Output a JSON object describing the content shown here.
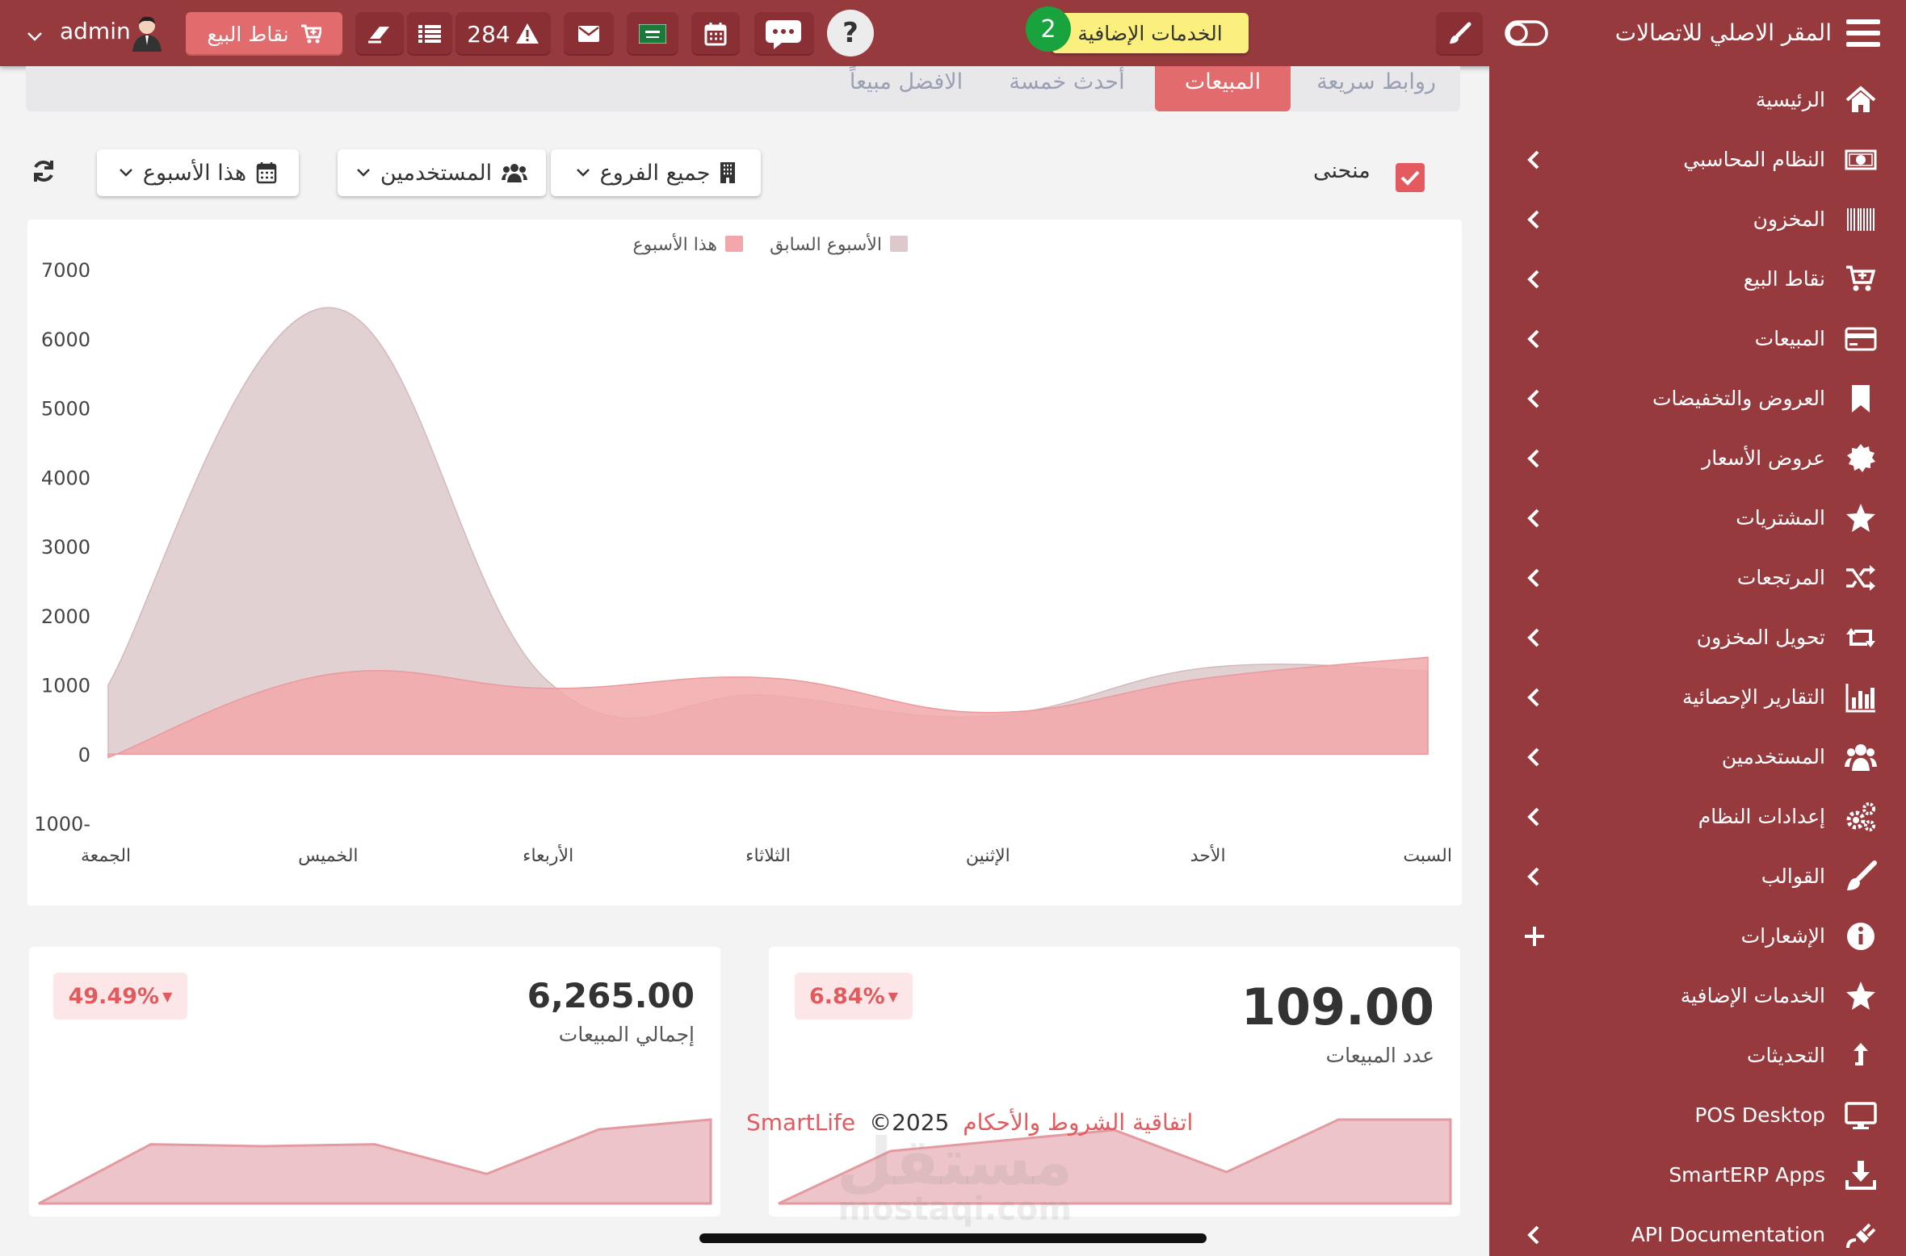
{
  "app": {
    "title": "المقر الاصلي للاتصالات"
  },
  "topbar": {
    "addons_label": "الخدمات الإضافية",
    "addons_badge": "2",
    "help_symbol": "?",
    "alerts_count": "284",
    "pos_label": "نقاط البيع",
    "user_name": "admin"
  },
  "sidebar": {
    "items": [
      {
        "label": "الرئيسية",
        "icon": "home-icon",
        "has_children": false
      },
      {
        "label": "النظام المحاسبي",
        "icon": "money-icon",
        "has_children": true
      },
      {
        "label": "المخزون",
        "icon": "barcode-icon",
        "has_children": true
      },
      {
        "label": "نقاط البيع",
        "icon": "cart-plus-icon",
        "has_children": true
      },
      {
        "label": "المبيعات",
        "icon": "credit-card-icon",
        "has_children": true
      },
      {
        "label": "العروض والتخفيضات",
        "icon": "bookmark-icon",
        "has_children": true
      },
      {
        "label": "عروض الأسعار",
        "icon": "certificate-icon",
        "has_children": true
      },
      {
        "label": "المشتريات",
        "icon": "star-icon",
        "has_children": true
      },
      {
        "label": "المرتجعات",
        "icon": "random-icon",
        "has_children": true
      },
      {
        "label": "تحويل المخزون",
        "icon": "retweet-icon",
        "has_children": true
      },
      {
        "label": "التقارير الإحصائية",
        "icon": "bar-chart-icon",
        "has_children": true
      },
      {
        "label": "المستخدمين",
        "icon": "users-icon",
        "has_children": true
      },
      {
        "label": "إعدادات النظام",
        "icon": "cogs-icon",
        "has_children": true
      },
      {
        "label": "القوالب",
        "icon": "brush-icon",
        "has_children": true
      },
      {
        "label": "الإشعارات",
        "icon": "info-icon",
        "has_children": false,
        "plus": true
      },
      {
        "label": "الخدمات الإضافية",
        "icon": "star-icon",
        "has_children": false
      },
      {
        "label": "التحديثات",
        "icon": "upload-arrow-icon",
        "has_children": false
      },
      {
        "label": "POS Desktop",
        "icon": "desktop-icon",
        "has_children": false
      },
      {
        "label": "SmartERP Apps",
        "icon": "download-icon",
        "has_children": false
      },
      {
        "label": "API Documentation",
        "icon": "plug-icon",
        "has_children": true
      }
    ]
  },
  "tabs": [
    {
      "label": "روابط سريعة",
      "active": false
    },
    {
      "label": "المبيعات",
      "active": true
    },
    {
      "label": "أحدث خمسة",
      "active": false
    },
    {
      "label": "الافضل مبيعاً",
      "active": false
    }
  ],
  "filters": {
    "curve_label": "منحنى",
    "curve_checked": true,
    "branches": "جميع الفروع",
    "users": "المستخدمين",
    "period": "هذا الأسبوع"
  },
  "chart_data": {
    "type": "area",
    "title": "",
    "xlabel": "",
    "ylabel": "",
    "x": [
      "الجمعة",
      "الخميس",
      "الأربعاء",
      "الثلاثاء",
      "الإثنين",
      "الأحد",
      "السبت"
    ],
    "ylim": [
      -1000,
      7000
    ],
    "yticks": [
      "7000",
      "6000",
      "5000",
      "4000",
      "3000",
      "2000",
      "1000",
      "0",
      "1000-"
    ],
    "series": [
      {
        "name": "الأسبوع السابق",
        "values": [
          1000,
          6450,
          1050,
          850,
          550,
          1250,
          1200
        ],
        "color": "#ddc9cb"
      },
      {
        "name": "هذا الأسبوع",
        "values": [
          -50,
          1150,
          950,
          1100,
          600,
          1100,
          1400
        ],
        "color": "#f2a8aa"
      }
    ],
    "legend_position": "top-center",
    "grid": false
  },
  "stats": {
    "count": {
      "value": "109.00",
      "label": "عدد المبيعات",
      "change": "6.84%",
      "sparkline": [
        0,
        5,
        6,
        7,
        3,
        8,
        8
      ]
    },
    "total": {
      "value": "6,265.00",
      "label": "إجمالي المبيعات",
      "change": "49.49%",
      "sparkline": [
        0,
        6,
        5.8,
        6,
        3,
        7.5,
        8.5
      ]
    }
  },
  "footer": {
    "terms": "اتفاقية الشروط والأحكام",
    "copyright": "©2025",
    "brand": "SmartLife"
  },
  "watermark": {
    "arabic": "مستقل",
    "latin": "mostaqi.com"
  },
  "colors": {
    "brand": "#963a3e",
    "accent": "#e26b6e",
    "checkbox": "#e45a5e"
  }
}
